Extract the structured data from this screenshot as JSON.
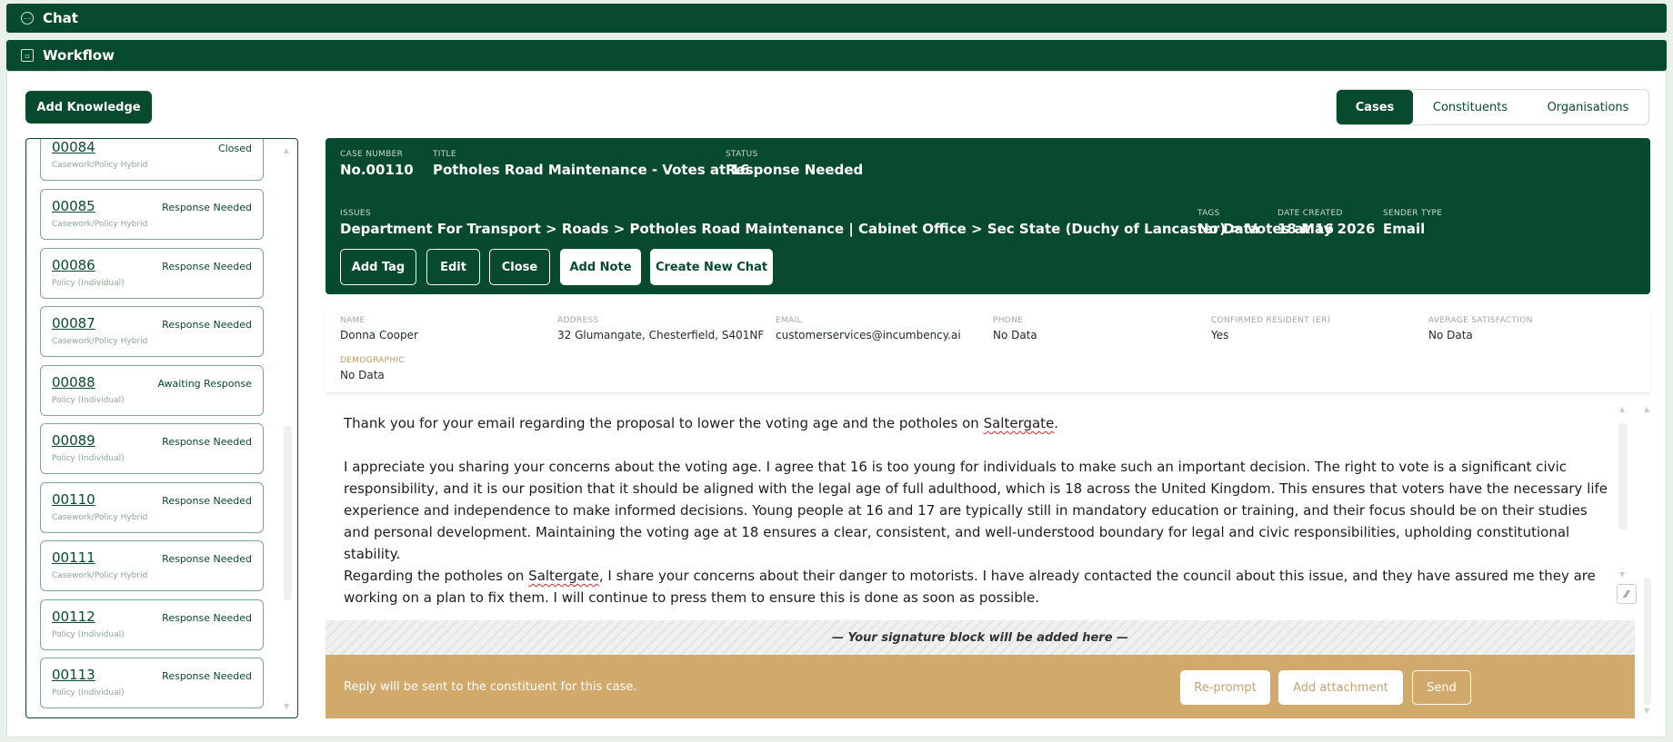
{
  "chat_bar": {
    "title": "Chat"
  },
  "workflow_bar": {
    "title": "Workflow"
  },
  "toolbar": {
    "add_knowledge": "Add Knowledge"
  },
  "tabs": [
    {
      "label": "Cases",
      "active": true
    },
    {
      "label": "Constituents",
      "active": false
    },
    {
      "label": "Organisations",
      "active": false
    }
  ],
  "case_list": [
    {
      "number": "00084",
      "status": "Closed",
      "type": "Casework/Policy Hybrid"
    },
    {
      "number": "00085",
      "status": "Response Needed",
      "type": "Casework/Policy Hybrid"
    },
    {
      "number": "00086",
      "status": "Response Needed",
      "type": "Policy (Individual)"
    },
    {
      "number": "00087",
      "status": "Response Needed",
      "type": "Casework/Policy Hybrid"
    },
    {
      "number": "00088",
      "status": "Awaiting Response",
      "type": "Policy (Individual)"
    },
    {
      "number": "00089",
      "status": "Response Needed",
      "type": "Policy (Individual)"
    },
    {
      "number": "00110",
      "status": "Response Needed",
      "type": "Casework/Policy Hybrid"
    },
    {
      "number": "00111",
      "status": "Response Needed",
      "type": "Casework/Policy Hybrid"
    },
    {
      "number": "00112",
      "status": "Response Needed",
      "type": "Policy (Individual)"
    },
    {
      "number": "00113",
      "status": "Response Needed",
      "type": "Policy (Individual)"
    }
  ],
  "case": {
    "case_number_label": "CASE NUMBER",
    "case_number": "No.00110",
    "title_label": "TITLE",
    "title": "Potholes Road Maintenance - Votes at 16",
    "status_label": "STATUS",
    "status": "Response Needed",
    "issues_label": "ISSUES",
    "issues": "Department For Transport > Roads > Potholes Road Maintenance | Cabinet Office > Sec State (Duchy of Lancaster) > Votes at 16",
    "tags_label": "TAGS",
    "tags": "No Data",
    "date_created_label": "DATE CREATED",
    "date_created": "18 May 2026",
    "sender_type_label": "SENDER TYPE",
    "sender_type": "Email",
    "buttons": {
      "add_tag": "Add Tag",
      "edit": "Edit",
      "close": "Close",
      "add_note": "Add Note",
      "create_new_chat": "Create New Chat"
    }
  },
  "constituent": {
    "name_label": "NAME",
    "name": "Donna Cooper",
    "address_label": "ADDRESS",
    "address": "32 Glumangate, Chesterfield, S401NF",
    "email_label": "EMAIL",
    "email": "customerservices@incumbency.ai",
    "phone_label": "PHONE",
    "phone": "No Data",
    "resident_label": "CONFIRMED RESIDENT (ER)",
    "resident": "Yes",
    "satisfaction_label": "AVERAGE SATISFACTION",
    "satisfaction": "No Data",
    "demographic_label": "DEMOGRAPHIC",
    "demographic": "No Data"
  },
  "letter": {
    "p1_before": "Thank you for your email regarding the proposal to lower the voting age and the potholes on ",
    "p1_word": "Saltergate",
    "p1_after": ".",
    "p2": "I appreciate you sharing your concerns about the voting age. I agree that 16 is too young for individuals to make such an important decision. The right to vote is a significant civic responsibility, and it is our position that it should be aligned with the legal age of full adulthood, which is 18 across the United Kingdom. This ensures that voters have the necessary life experience and independence to make informed decisions. Young people at 16 and 17 are typically still in mandatory education or training, and their focus should be on their studies and personal development. Maintaining the voting age at 18 ensures a clear, consistent, and well-understood boundary for legal and civic responsibilities, upholding constitutional stability.",
    "p3_before": "Regarding the potholes on ",
    "p3_word": "Saltergate",
    "p3_after": ", I share your concerns about their danger to motorists. I have already contacted the council about this issue, and they have assured me they are working on a plan to fix them. I will continue to press them to ensure this is done as soon as possible."
  },
  "signature": {
    "text": "— Your signature block will be added here —"
  },
  "reply": {
    "note": "Reply will be sent to the constituent for this case.",
    "reprompt": "Re-prompt",
    "add_attachment": "Add attachment",
    "send": "Send"
  },
  "colors": {
    "primary": "#074a2e",
    "accent": "#d1a96b",
    "background": "#e9efe9"
  },
  "icons": {
    "chat": "chat-bubble-icon",
    "workflow": "workflow-icon",
    "scroll_up": "chevron-up-icon",
    "scroll_down": "chevron-down-icon",
    "resize": "resize-icon"
  }
}
